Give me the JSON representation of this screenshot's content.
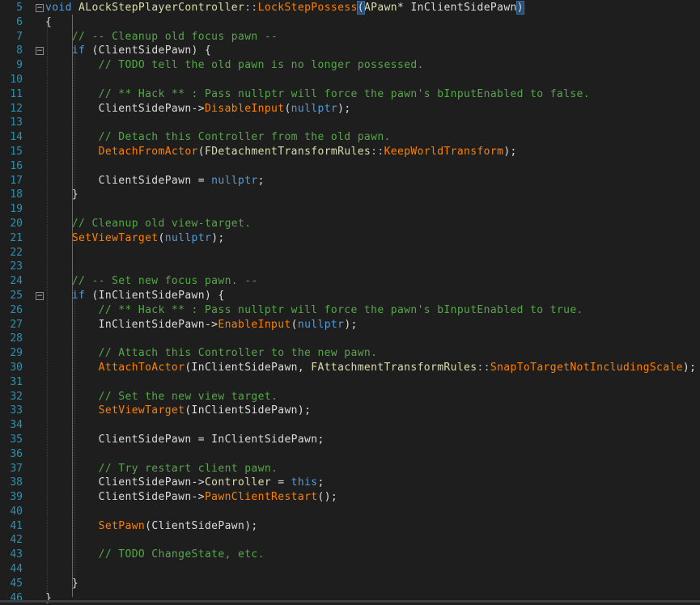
{
  "editor": {
    "language": "C++",
    "lines": [
      {
        "n": "5",
        "tokens": [
          [
            "kw",
            "void"
          ],
          [
            "t",
            " "
          ],
          [
            "ty-y",
            "ALockStepPlayerController"
          ],
          [
            "op",
            "::"
          ],
          [
            "fn",
            "LockStepPossess"
          ],
          [
            "sel",
            "("
          ],
          [
            "ty-y",
            "APawn"
          ],
          [
            "t",
            "* "
          ],
          [
            "t",
            "InClientSidePawn"
          ],
          [
            "sel",
            ")"
          ]
        ]
      },
      {
        "n": "6",
        "tokens": [
          [
            "t",
            "{"
          ]
        ]
      },
      {
        "n": "7",
        "tokens": [
          [
            "t",
            "    "
          ],
          [
            "cm",
            "// -- Cleanup old focus pawn --"
          ]
        ]
      },
      {
        "n": "8",
        "tokens": [
          [
            "t",
            "    "
          ],
          [
            "kw",
            "if"
          ],
          [
            "t",
            " (ClientSidePawn) {"
          ]
        ]
      },
      {
        "n": "9",
        "tokens": [
          [
            "t",
            "        "
          ],
          [
            "cm",
            "// TODO tell the old pawn is no longer possessed."
          ]
        ]
      },
      {
        "n": "10",
        "tokens": []
      },
      {
        "n": "11",
        "tokens": [
          [
            "t",
            "        "
          ],
          [
            "cm",
            "// ** Hack ** : Pass nullptr will force the pawn's bInputEnabled to false."
          ]
        ]
      },
      {
        "n": "12",
        "tokens": [
          [
            "t",
            "        ClientSidePawn->"
          ],
          [
            "fn",
            "DisableInput"
          ],
          [
            "t",
            "("
          ],
          [
            "kw",
            "nullptr"
          ],
          [
            "t",
            ");"
          ]
        ]
      },
      {
        "n": "13",
        "tokens": []
      },
      {
        "n": "14",
        "tokens": [
          [
            "t",
            "        "
          ],
          [
            "cm",
            "// Detach this Controller from the old pawn."
          ]
        ]
      },
      {
        "n": "15",
        "tokens": [
          [
            "t",
            "        "
          ],
          [
            "fn",
            "DetachFromActor"
          ],
          [
            "t",
            "("
          ],
          [
            "ty-y",
            "FDetachmentTransformRules"
          ],
          [
            "op",
            "::"
          ],
          [
            "fn",
            "KeepWorldTransform"
          ],
          [
            "t",
            ");"
          ]
        ]
      },
      {
        "n": "16",
        "tokens": []
      },
      {
        "n": "17",
        "tokens": [
          [
            "t",
            "        ClientSidePawn = "
          ],
          [
            "kw",
            "nullptr"
          ],
          [
            "t",
            ";"
          ]
        ]
      },
      {
        "n": "18",
        "tokens": [
          [
            "t",
            "    }"
          ]
        ]
      },
      {
        "n": "19",
        "tokens": []
      },
      {
        "n": "20",
        "tokens": [
          [
            "t",
            "    "
          ],
          [
            "cm",
            "// Cleanup old view-target."
          ]
        ]
      },
      {
        "n": "21",
        "tokens": [
          [
            "t",
            "    "
          ],
          [
            "fn",
            "SetViewTarget"
          ],
          [
            "t",
            "("
          ],
          [
            "kw",
            "nullptr"
          ],
          [
            "t",
            ");"
          ]
        ]
      },
      {
        "n": "22",
        "tokens": []
      },
      {
        "n": "23",
        "tokens": []
      },
      {
        "n": "24",
        "tokens": [
          [
            "t",
            "    "
          ],
          [
            "cm",
            "// -- Set new focus pawn. --"
          ]
        ]
      },
      {
        "n": "25",
        "tokens": [
          [
            "t",
            "    "
          ],
          [
            "kw",
            "if"
          ],
          [
            "t",
            " (InClientSidePawn) {"
          ]
        ]
      },
      {
        "n": "26",
        "tokens": [
          [
            "t",
            "        "
          ],
          [
            "cm",
            "// ** Hack ** : Pass nullptr will force the pawn's bInputEnabled to true."
          ]
        ]
      },
      {
        "n": "27",
        "tokens": [
          [
            "t",
            "        InClientSidePawn->"
          ],
          [
            "fn",
            "EnableInput"
          ],
          [
            "t",
            "("
          ],
          [
            "kw",
            "nullptr"
          ],
          [
            "t",
            ");"
          ]
        ]
      },
      {
        "n": "28",
        "tokens": []
      },
      {
        "n": "29",
        "tokens": [
          [
            "t",
            "        "
          ],
          [
            "cm",
            "// Attach this Controller to the new pawn."
          ]
        ]
      },
      {
        "n": "30",
        "tokens": [
          [
            "t",
            "        "
          ],
          [
            "fn",
            "AttachToActor"
          ],
          [
            "t",
            "(InClientSidePawn, "
          ],
          [
            "ty-y",
            "FAttachmentTransformRules"
          ],
          [
            "op",
            "::"
          ],
          [
            "fn",
            "SnapToTargetNotIncludingScale"
          ],
          [
            "t",
            ");"
          ]
        ]
      },
      {
        "n": "31",
        "tokens": []
      },
      {
        "n": "32",
        "tokens": [
          [
            "t",
            "        "
          ],
          [
            "cm",
            "// Set the new view target."
          ]
        ]
      },
      {
        "n": "33",
        "tokens": [
          [
            "t",
            "        "
          ],
          [
            "fn",
            "SetViewTarget"
          ],
          [
            "t",
            "(InClientSidePawn);"
          ]
        ]
      },
      {
        "n": "34",
        "tokens": []
      },
      {
        "n": "35",
        "tokens": [
          [
            "t",
            "        ClientSidePawn = InClientSidePawn;"
          ]
        ]
      },
      {
        "n": "36",
        "tokens": []
      },
      {
        "n": "37",
        "tokens": [
          [
            "t",
            "        "
          ],
          [
            "cm",
            "// Try restart client pawn."
          ]
        ]
      },
      {
        "n": "38",
        "tokens": [
          [
            "t",
            "        ClientSidePawn->"
          ],
          [
            "ty-y",
            "Controller"
          ],
          [
            "t",
            " = "
          ],
          [
            "kw",
            "this"
          ],
          [
            "t",
            ";"
          ]
        ]
      },
      {
        "n": "39",
        "tokens": [
          [
            "t",
            "        ClientSidePawn->"
          ],
          [
            "fn",
            "PawnClientRestart"
          ],
          [
            "t",
            "();"
          ]
        ]
      },
      {
        "n": "40",
        "tokens": []
      },
      {
        "n": "41",
        "tokens": [
          [
            "t",
            "        "
          ],
          [
            "fn",
            "SetPawn"
          ],
          [
            "t",
            "(ClientSidePawn);"
          ]
        ]
      },
      {
        "n": "42",
        "tokens": []
      },
      {
        "n": "43",
        "tokens": [
          [
            "t",
            "        "
          ],
          [
            "cm",
            "// TODO ChangeState, etc."
          ]
        ]
      },
      {
        "n": "44",
        "tokens": []
      },
      {
        "n": "45",
        "tokens": [
          [
            "t",
            "    }"
          ]
        ]
      },
      {
        "n": "46",
        "tokens": [
          [
            "t",
            "}"
          ]
        ]
      }
    ],
    "collapse_marker": "−",
    "colors": {
      "background": "#1e1e1e",
      "line_number": "#2b91af",
      "keyword": "#569cd6",
      "function": "#ff8000",
      "type": "#dcdcaa",
      "comment": "#57a64a",
      "text": "#dcdcdc",
      "brace_highlight": "#264f78"
    }
  }
}
